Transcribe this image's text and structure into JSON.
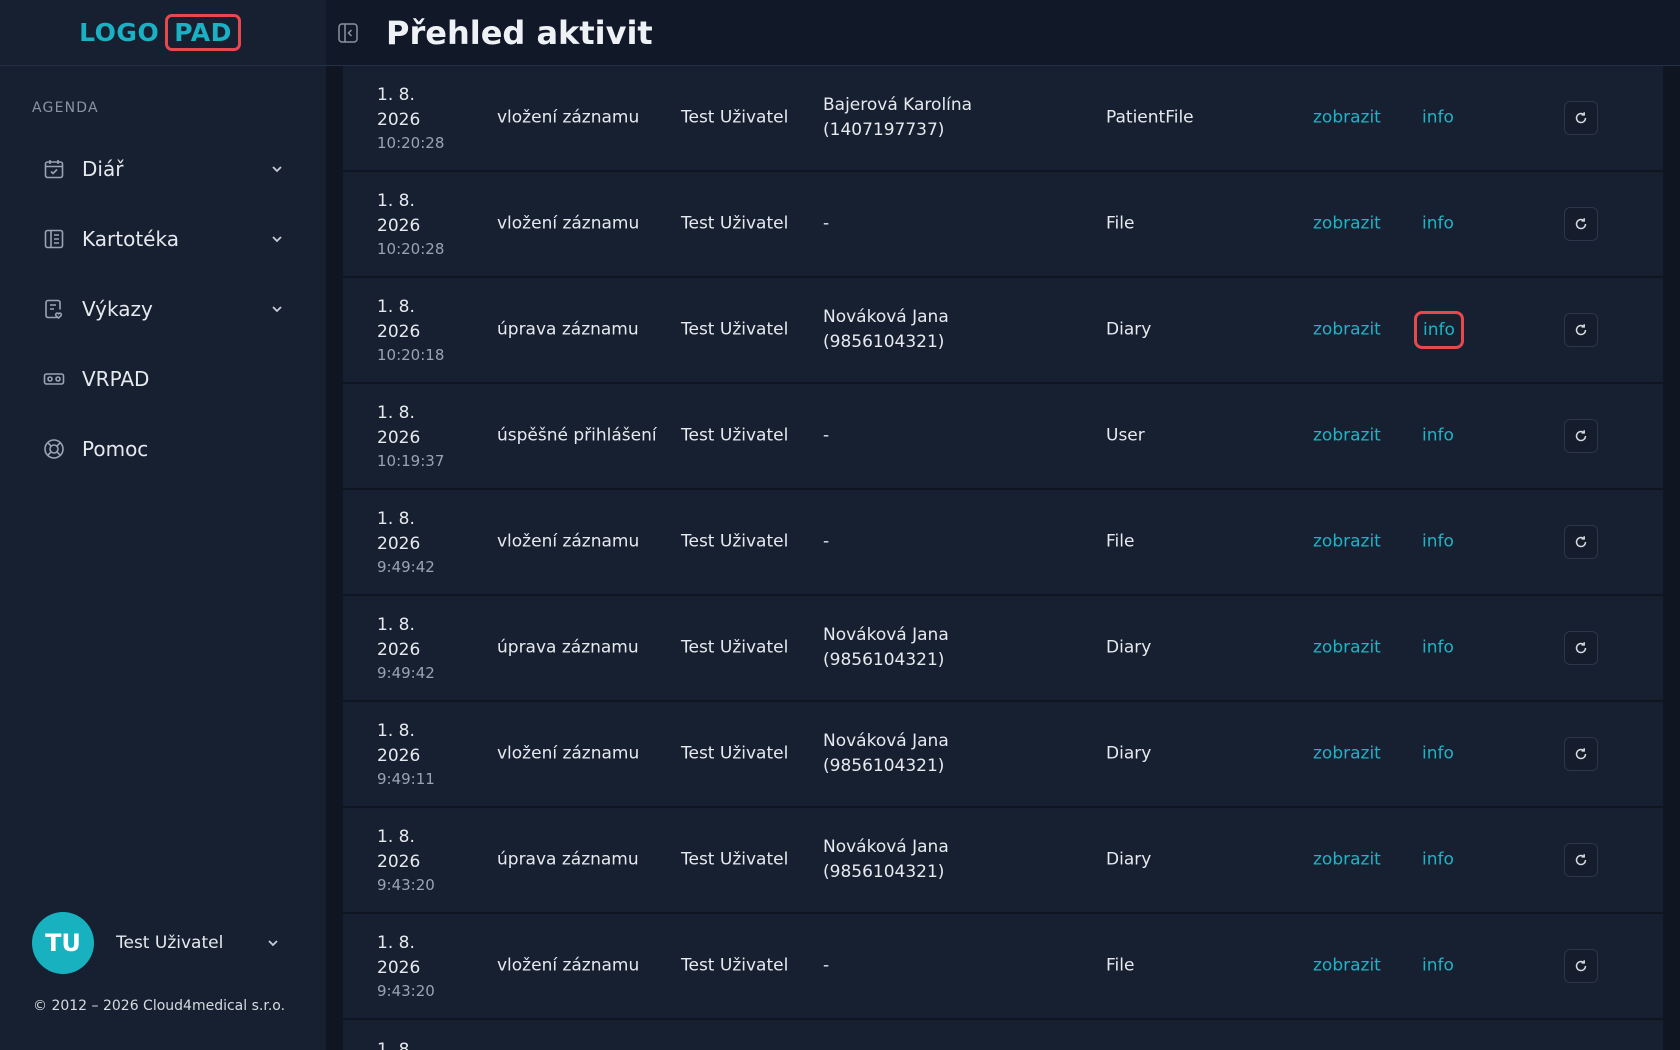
{
  "logo": {
    "word": "LOGO",
    "boxed": "PAD"
  },
  "sidebar": {
    "section_label": "AGENDA",
    "items": [
      {
        "label": "Diář",
        "icon": "calendar-check-icon",
        "has_submenu": true
      },
      {
        "label": "Kartotéka",
        "icon": "card-file-icon",
        "has_submenu": true
      },
      {
        "label": "Výkazy",
        "icon": "report-icon",
        "has_submenu": true
      },
      {
        "label": "VRPAD",
        "icon": "vr-headset-icon",
        "has_submenu": false
      },
      {
        "label": "Pomoc",
        "icon": "lifebuoy-icon",
        "has_submenu": false
      }
    ],
    "user": {
      "initials": "TU",
      "name": "Test Uživatel"
    },
    "copyright": "© 2012 – 2026 Cloud4medical s.r.o."
  },
  "header": {
    "title": "Přehled aktivit"
  },
  "rows": [
    {
      "date": "1. 8.",
      "year": "2026",
      "time": "10:20:28",
      "action": "vložení záznamu",
      "user": "Test Uživatel",
      "patient": "Bajerová Karolína (1407197737)",
      "entity": "PatientFile",
      "link_view": "zobrazit",
      "link_info": "info",
      "highlight": false
    },
    {
      "date": "1. 8.",
      "year": "2026",
      "time": "10:20:28",
      "action": "vložení záznamu",
      "user": "Test Uživatel",
      "patient": "-",
      "entity": "File",
      "link_view": "zobrazit",
      "link_info": "info",
      "highlight": false
    },
    {
      "date": "1. 8.",
      "year": "2026",
      "time": "10:20:18",
      "action": "úprava záznamu",
      "user": "Test Uživatel",
      "patient": "Nováková Jana (9856104321)",
      "entity": "Diary",
      "link_view": "zobrazit",
      "link_info": "info",
      "highlight": true
    },
    {
      "date": "1. 8.",
      "year": "2026",
      "time": "10:19:37",
      "action": "úspěšné přihlášení",
      "user": "Test Uživatel",
      "patient": "-",
      "entity": "User",
      "link_view": "zobrazit",
      "link_info": "info",
      "highlight": false
    },
    {
      "date": "1. 8.",
      "year": "2026",
      "time": "9:49:42",
      "action": "vložení záznamu",
      "user": "Test Uživatel",
      "patient": "-",
      "entity": "File",
      "link_view": "zobrazit",
      "link_info": "info",
      "highlight": false
    },
    {
      "date": "1. 8.",
      "year": "2026",
      "time": "9:49:42",
      "action": "úprava záznamu",
      "user": "Test Uživatel",
      "patient": "Nováková Jana (9856104321)",
      "entity": "Diary",
      "link_view": "zobrazit",
      "link_info": "info",
      "highlight": false
    },
    {
      "date": "1. 8.",
      "year": "2026",
      "time": "9:49:11",
      "action": "vložení záznamu",
      "user": "Test Uživatel",
      "patient": "Nováková Jana (9856104321)",
      "entity": "Diary",
      "link_view": "zobrazit",
      "link_info": "info",
      "highlight": false
    },
    {
      "date": "1. 8.",
      "year": "2026",
      "time": "9:43:20",
      "action": "úprava záznamu",
      "user": "Test Uživatel",
      "patient": "Nováková Jana (9856104321)",
      "entity": "Diary",
      "link_view": "zobrazit",
      "link_info": "info",
      "highlight": false
    },
    {
      "date": "1. 8.",
      "year": "2026",
      "time": "9:43:20",
      "action": "vložení záznamu",
      "user": "Test Uživatel",
      "patient": "-",
      "entity": "File",
      "link_view": "zobrazit",
      "link_info": "info",
      "highlight": false
    }
  ],
  "partial_row": {
    "date": "1. 8."
  },
  "colors": {
    "accent": "#1fb3c6",
    "highlight": "#e5484d",
    "sidebar_bg": "#172030",
    "page_bg": "#0f1521"
  }
}
